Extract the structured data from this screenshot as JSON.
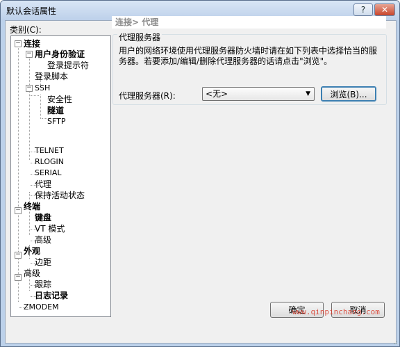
{
  "window": {
    "title": "默认会话属性",
    "help_label": "?",
    "close_label": "✕"
  },
  "category_label": "类别(C):",
  "tree": {
    "connection": "连接",
    "user_auth": "用户身份验证",
    "login_prompt": "登录提示符",
    "login_script": "登录脚本",
    "ssh": "SSH",
    "security": "安全性",
    "tunnel": "隧道",
    "sftp": "SFTP",
    "telnet": "TELNET",
    "rlogin": "RLOGIN",
    "serial": "SERIAL",
    "proxy": "代理",
    "keepalive": "保持活动状态",
    "terminal": "终端",
    "keyboard": "键盘",
    "vt_mode": "VT 模式",
    "advanced": "高级",
    "appearance": "外观",
    "margin": "边距",
    "advanced2": "高级",
    "trace": "跟踪",
    "logging": "日志记录",
    "zmodem": "ZMODEM"
  },
  "panel": {
    "header": "连接> 代理",
    "group_title": "代理服务器",
    "description": "用户的网络环境使用代理服务器防火墙时请在如下列表中选择恰当的服务器。若要添加/编辑/删除代理服务器的话请点击\"浏览\"。",
    "proxy_label": "代理服务器(R):",
    "proxy_value": "<无>",
    "browse_label": "浏览(B)..."
  },
  "buttons": {
    "ok": "确定",
    "cancel": "取消"
  },
  "watermark": "www.qinpinchang.com"
}
